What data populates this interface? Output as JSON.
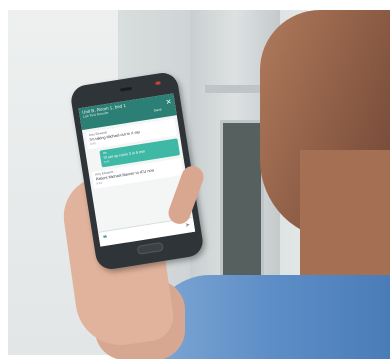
{
  "phone": {
    "appbar": {
      "title": "Unit B, Room 1, bed 1",
      "subtitle": "Lab Test Results",
      "save_label": "Save",
      "close_icon": "close-icon"
    },
    "messages": [
      {
        "sender": "Amy Edwards",
        "body": "I'm taking Michael out to X-ray",
        "time": "9:40",
        "type": "incoming"
      },
      {
        "sender": "Me",
        "body": "I'll set up room 3 in 5 min",
        "time": "9:41",
        "type": "outgoing"
      },
      {
        "sender": "Amy Edwards",
        "body": "Patient Michael Banner to ICU now",
        "time": "9:43",
        "type": "incoming"
      }
    ],
    "composer": {
      "quote_icon": "quote-icon",
      "send_icon": "send-icon"
    },
    "accent_color": "#2c7f74",
    "bubble_color": "#3fb8a5"
  }
}
